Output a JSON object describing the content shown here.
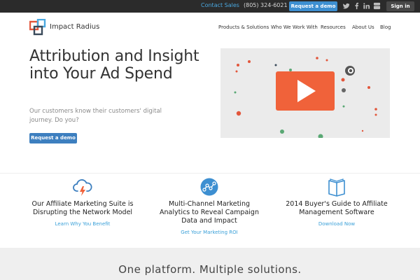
{
  "topbar": {
    "contact_sales": "Contact Sales",
    "phone": "(805) 324-6021",
    "request_demo": "Request a demo",
    "sign_in": "Sign in",
    "social_icons": [
      "twitter-icon",
      "facebook-icon",
      "linkedin-icon",
      "youtube-icon"
    ]
  },
  "header": {
    "brand": "Impact Radius",
    "nav": [
      {
        "label": "Products & Solutions"
      },
      {
        "label": "Who We Work With"
      },
      {
        "label": "Resources"
      },
      {
        "label": "About Us"
      },
      {
        "label": "Blog"
      }
    ]
  },
  "hero": {
    "title": "Attribution and Insight into Your Ad Spend",
    "subtitle": "Our customers know their customers' digital journey. Do you?",
    "button": "Request a demo",
    "video_icon": "play-icon"
  },
  "features": [
    {
      "icon": "cloud-lightning-icon",
      "title": "Our Affiliate Marketing Suite is Disrupting the Network Model",
      "link": "Learn Why You Benefit"
    },
    {
      "icon": "analytics-network-icon",
      "title": "Multi-Channel Marketing Analytics to Reveal Campaign Data and Impact",
      "link": "Get Your Marketing ROI"
    },
    {
      "icon": "book-icon",
      "title": "2014 Buyer's Guide to Affiliate Management Software",
      "link": "Download Now"
    }
  ],
  "band": {
    "title": "One platform. Multiple solutions."
  },
  "colors": {
    "accent_blue": "#3d8fd1",
    "link_blue": "#3aa0d8",
    "video_orange": "#f0623a",
    "dot_green": "#5aa874",
    "topbar_bg": "#2b2b2b"
  }
}
